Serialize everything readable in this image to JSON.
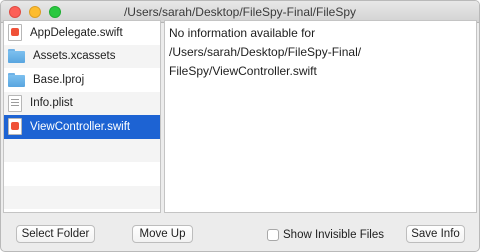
{
  "window": {
    "title": "/Users/sarah/Desktop/FileSpy-Final/FileSpy"
  },
  "file_list": {
    "items": [
      {
        "label": "AppDelegate.swift",
        "icon": "swift-file-icon",
        "selected": false
      },
      {
        "label": "Assets.xcassets",
        "icon": "folder-icon",
        "selected": false
      },
      {
        "label": "Base.lproj",
        "icon": "folder-icon",
        "selected": false
      },
      {
        "label": "Info.plist",
        "icon": "plist-file-icon",
        "selected": false
      },
      {
        "label": "ViewController.swift",
        "icon": "swift-file-icon",
        "selected": true
      }
    ]
  },
  "info": {
    "text": "No information available for /Users/sarah/Desktop/FileSpy-Final/\nFileSpy/ViewController.swift"
  },
  "buttons": {
    "select_folder": "Select Folder",
    "move_up": "Move Up",
    "save_info": "Save Info"
  },
  "options": {
    "show_invisible_label": "Show Invisible Files",
    "show_invisible_checked": false
  },
  "colors": {
    "selection": "#1d63d3",
    "close": "#fc5f57",
    "minimize": "#fdbc2e",
    "zoom": "#29c840"
  }
}
